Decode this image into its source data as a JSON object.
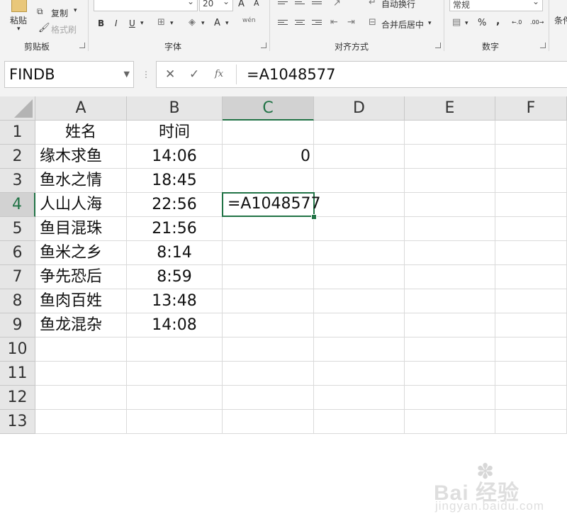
{
  "ribbon": {
    "clipboard": {
      "paste_label": "粘贴",
      "copy_label": "复制",
      "format_painter_label": "格式刷",
      "group_label": "剪贴板"
    },
    "font": {
      "font_name": "",
      "font_size": "20",
      "bold": "B",
      "italic": "I",
      "underline": "U",
      "grow": "A",
      "shrink": "A",
      "font_color": "A",
      "phonetic": "wén",
      "group_label": "字体"
    },
    "alignment": {
      "wrap_text_label": "自动换行",
      "merge_center_label": "合并后居中",
      "group_label": "对齐方式"
    },
    "number": {
      "format_value": "常规",
      "percent": "%",
      "comma": ",",
      "increase_decimal": "←.0",
      "decrease_decimal": ".00→",
      "group_label": "数字"
    },
    "styles": {
      "conditional_label": "条件"
    }
  },
  "formula_bar": {
    "name_box": "FINDB",
    "cancel": "✕",
    "enter": "✓",
    "fx": "fx",
    "content": "=A1048577"
  },
  "sheet": {
    "columns": [
      "A",
      "B",
      "C",
      "D",
      "E",
      "F"
    ],
    "active_column": "C",
    "rows": [
      "1",
      "2",
      "3",
      "4",
      "5",
      "6",
      "7",
      "8",
      "9",
      "10",
      "11",
      "12",
      "13"
    ],
    "active_row": "4",
    "col_a": [
      "姓名",
      "缘木求鱼",
      "鱼水之情",
      "人山人海",
      "鱼目混珠",
      "鱼米之乡",
      "争先恐后",
      "鱼肉百姓",
      "鱼龙混杂"
    ],
    "col_b": [
      "时间",
      "14:06",
      "18:45",
      "22:56",
      "21:56",
      "8:14",
      "8:59",
      "13:48",
      "14:08"
    ],
    "c2": "0",
    "c4_editing": "=A1048577"
  },
  "watermark": {
    "brand": "Bai 经验",
    "url": "jingyan.baidu.com"
  },
  "colors": {
    "accent": "#217346",
    "header_bg": "#e6e6e6",
    "ribbon_bg": "#f3f3f3"
  }
}
